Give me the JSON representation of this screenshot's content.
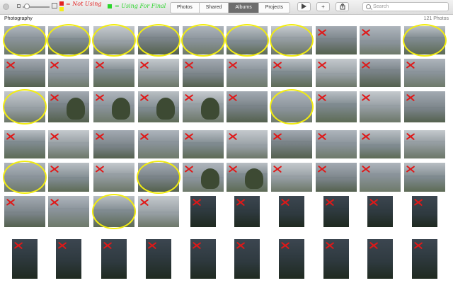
{
  "toolbar": {
    "tabs": [
      {
        "label": "Photos",
        "active": false
      },
      {
        "label": "Shared",
        "active": false
      },
      {
        "label": "Albums",
        "active": true
      },
      {
        "label": "Projects",
        "active": false
      }
    ],
    "play_icon": "play-icon",
    "add_icon": "plus-icon",
    "share_icon": "share-icon",
    "search_placeholder": "Search",
    "annotations": {
      "red_label": "= Not Using",
      "yellow_label": "",
      "green_label": "= Using For Final"
    },
    "colors": {
      "red": "#e32222",
      "yellow": "#f5ee1a",
      "green": "#2bd52b"
    }
  },
  "album": {
    "title": "Photography",
    "count_label": "121 Photos"
  },
  "photo_marks": [
    [
      "circle",
      "circle",
      "circle",
      "circle",
      "circle",
      "circle",
      "circle",
      "x",
      "x",
      "circle"
    ],
    [
      "x",
      "x",
      "x",
      "x",
      "x",
      "x",
      "x",
      "x",
      "x",
      "x"
    ],
    [
      "circle",
      "x",
      "x",
      "x",
      "x",
      "x",
      "circle",
      "x",
      "x",
      "x"
    ],
    [
      "x",
      "x",
      "x",
      "x",
      "x",
      "x",
      "x",
      "x",
      "x",
      "x"
    ],
    [
      "circle",
      "x",
      "x",
      "circle",
      "x",
      "x",
      "x",
      "x",
      "x",
      "x"
    ],
    [
      "x",
      "x",
      "circle",
      "x",
      "x",
      "x",
      "x",
      "x",
      "x",
      "x"
    ],
    [
      "x",
      "x",
      "x",
      "x",
      "x",
      "x",
      "x",
      "x",
      "x",
      "x"
    ]
  ]
}
